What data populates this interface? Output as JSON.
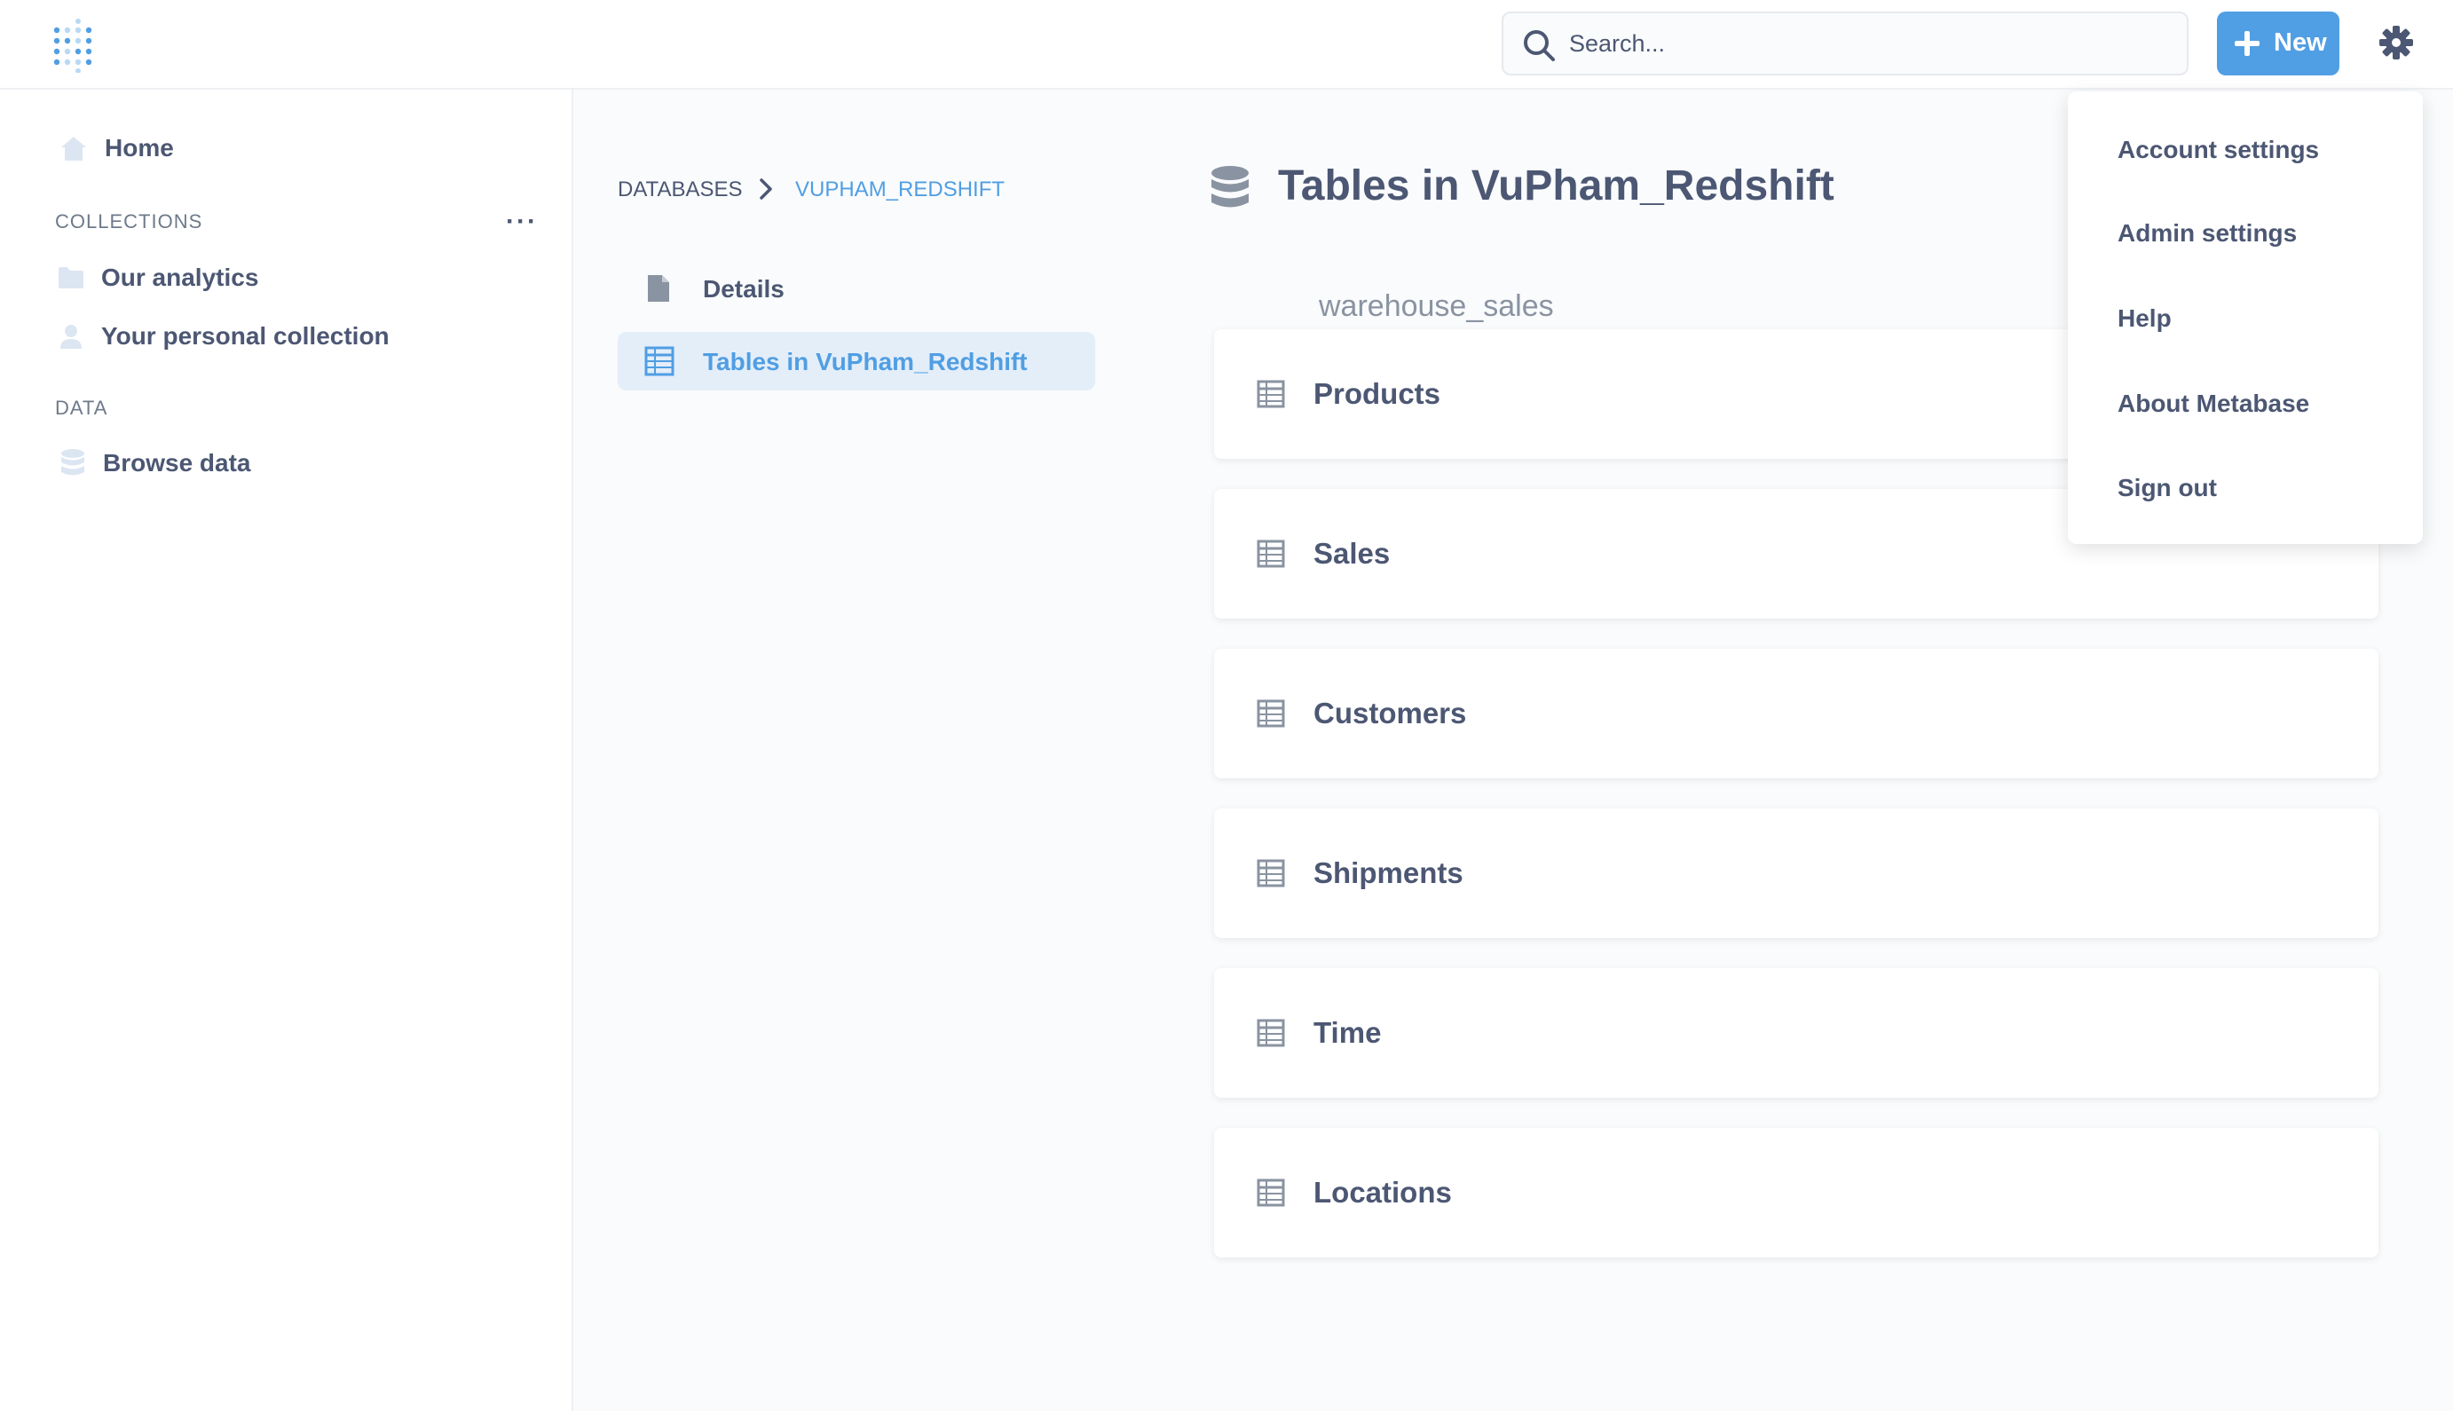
{
  "header": {
    "logo_icon": "metabase-logo-icon",
    "search": {
      "placeholder": "Search..."
    },
    "new_button_label": "New",
    "settings_icon": "gear-icon",
    "accent_color": "#509ee3"
  },
  "sidebar": {
    "home_label": "Home",
    "collections_header": "COLLECTIONS",
    "collections": [
      {
        "label": "Our analytics",
        "icon": "folder-icon"
      },
      {
        "label": "Your personal collection",
        "icon": "person-icon"
      }
    ],
    "data_header": "DATA",
    "browse_label": "Browse data"
  },
  "breadcrumb": {
    "root": "DATABASES",
    "current": "VUPHAM_REDSHIFT"
  },
  "nav": {
    "details_label": "Details",
    "tables_label": "Tables in VuPham_Redshift"
  },
  "main": {
    "title": "Tables in VuPham_Redshift",
    "schema": "warehouse_sales",
    "tables": [
      "Products",
      "Sales",
      "Customers",
      "Shipments",
      "Time",
      "Locations"
    ]
  },
  "menu": {
    "items": [
      "Account settings",
      "Admin settings",
      "Help",
      "About Metabase",
      "Sign out"
    ]
  }
}
